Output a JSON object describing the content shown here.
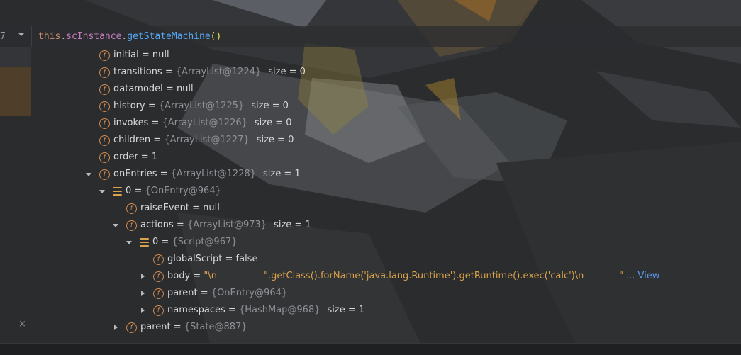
{
  "expression": {
    "line_number": "7",
    "tokens": {
      "this": "this",
      "dot1": ".",
      "field": "scInstance",
      "dot2": ".",
      "method": "getStateMachine",
      "parens": "()"
    }
  },
  "gutter": {
    "close_glyph": "×"
  },
  "tree": [
    {
      "indent": 0,
      "arrow": "none",
      "icon": "field-icon",
      "name": "initial",
      "eq": " = ",
      "value": "null",
      "value_type": "kw",
      "size": ""
    },
    {
      "indent": 0,
      "arrow": "none",
      "icon": "field-icon",
      "name": "transitions",
      "eq": " = ",
      "value": "{ArrayList@1224}",
      "value_type": "ref",
      "size": "size = 0"
    },
    {
      "indent": 0,
      "arrow": "none",
      "icon": "field-icon",
      "name": "datamodel",
      "eq": " = ",
      "value": "null",
      "value_type": "kw",
      "size": ""
    },
    {
      "indent": 0,
      "arrow": "none",
      "icon": "field-icon",
      "name": "history",
      "eq": " = ",
      "value": "{ArrayList@1225}",
      "value_type": "ref",
      "size": "size = 0"
    },
    {
      "indent": 0,
      "arrow": "none",
      "icon": "field-icon",
      "name": "invokes",
      "eq": " = ",
      "value": "{ArrayList@1226}",
      "value_type": "ref",
      "size": "size = 0"
    },
    {
      "indent": 0,
      "arrow": "none",
      "icon": "field-icon",
      "name": "children",
      "eq": " = ",
      "value": "{ArrayList@1227}",
      "value_type": "ref",
      "size": "size = 0"
    },
    {
      "indent": 0,
      "arrow": "none",
      "icon": "field-icon",
      "name": "order",
      "eq": " = ",
      "value": "1",
      "value_type": "kw",
      "size": ""
    },
    {
      "indent": 0,
      "arrow": "down",
      "icon": "field-icon",
      "name": "onEntries",
      "eq": " = ",
      "value": "{ArrayList@1228}",
      "value_type": "ref",
      "size": "size = 1"
    },
    {
      "indent": 1,
      "arrow": "down",
      "icon": "array-element-icon",
      "name": "0",
      "eq": " = ",
      "value": "{OnEntry@964}",
      "value_type": "ref",
      "size": ""
    },
    {
      "indent": 2,
      "arrow": "none",
      "icon": "field-icon",
      "name": "raiseEvent",
      "eq": " = ",
      "value": "null",
      "value_type": "kw",
      "size": ""
    },
    {
      "indent": 2,
      "arrow": "down",
      "icon": "field-icon",
      "name": "actions",
      "eq": " = ",
      "value": "{ArrayList@973}",
      "value_type": "ref",
      "size": "size = 1"
    },
    {
      "indent": 3,
      "arrow": "down",
      "icon": "array-element-icon",
      "name": "0",
      "eq": " = ",
      "value": "{Script@967}",
      "value_type": "ref",
      "size": ""
    },
    {
      "indent": 4,
      "arrow": "none",
      "icon": "field-icon",
      "name": "globalScript",
      "eq": " = ",
      "value": "false",
      "value_type": "kw",
      "size": ""
    },
    {
      "indent": 4,
      "arrow": "right",
      "icon": "field-icon",
      "name": "body",
      "eq": " = ",
      "value": "\"\\n                \".getClass().forName('java.lang.Runtime').getRuntime().exec('calc')\\n            \"",
      "value_type": "str",
      "size": "",
      "link": "... View"
    },
    {
      "indent": 4,
      "arrow": "right",
      "icon": "field-icon",
      "name": "parent",
      "eq": " = ",
      "value": "{OnEntry@964}",
      "value_type": "ref",
      "size": ""
    },
    {
      "indent": 4,
      "arrow": "right",
      "icon": "field-icon",
      "name": "namespaces",
      "eq": " = ",
      "value": "{HashMap@968}",
      "value_type": "ref",
      "size": "size = 1"
    },
    {
      "indent": 2,
      "arrow": "right",
      "icon": "field-icon",
      "name": "parent",
      "eq": " = ",
      "value": "{State@887}",
      "value_type": "ref",
      "size": ""
    }
  ],
  "colors": {
    "field_icon": "#d08a50",
    "string_value": "#d9a24a",
    "reference_value": "#8e9196",
    "link": "#5a9bf0",
    "method": "#56a8f5",
    "keyword_this": "#cf8e6d",
    "field_name_in_expr": "#c77dbb"
  }
}
